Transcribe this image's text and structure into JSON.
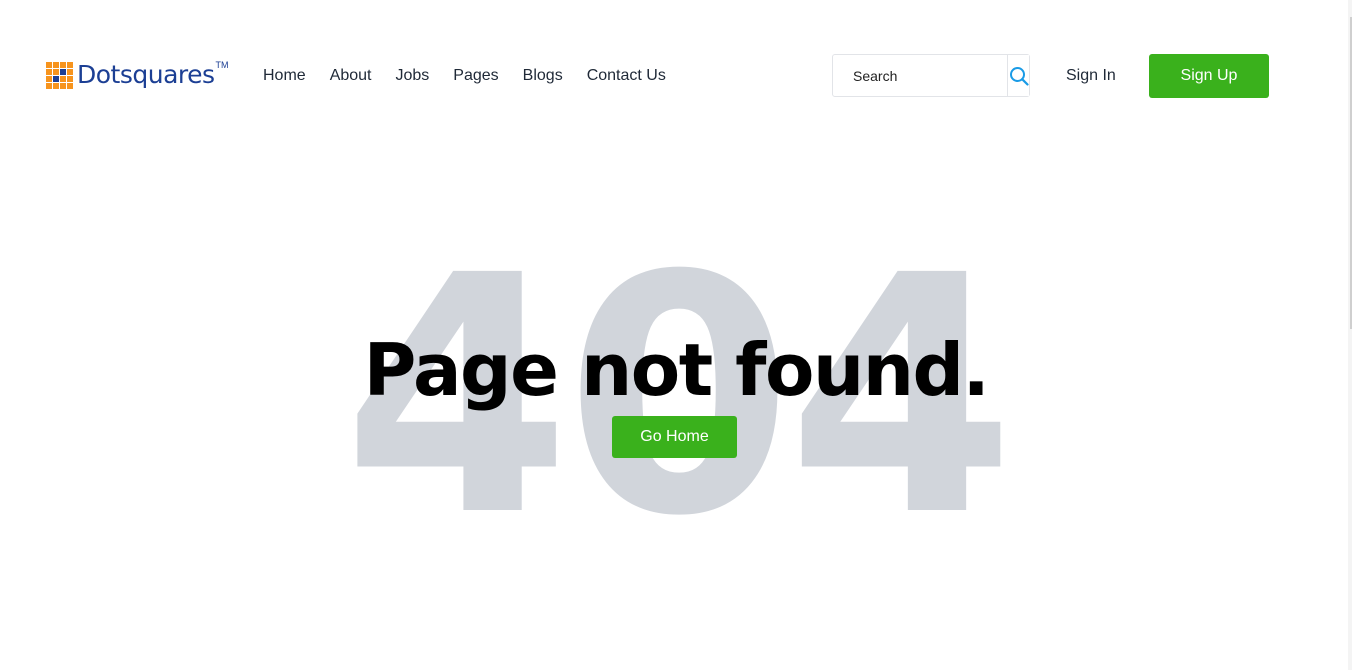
{
  "brand": {
    "name": "Dotsquares",
    "trademark": "TM",
    "colors": {
      "orange": "#f7941d",
      "navy": "#1c3f94"
    }
  },
  "nav": {
    "items": [
      {
        "label": "Home"
      },
      {
        "label": "About"
      },
      {
        "label": "Jobs"
      },
      {
        "label": "Pages"
      },
      {
        "label": "Blogs"
      },
      {
        "label": "Contact Us"
      }
    ]
  },
  "search": {
    "placeholder": "Search",
    "value": "",
    "icon": "search-icon",
    "icon_color": "#1a9be6"
  },
  "auth": {
    "sign_in_label": "Sign In",
    "sign_up_label": "Sign Up",
    "accent_color": "#3ab11c"
  },
  "error": {
    "code": "404",
    "headline": "Page not found.",
    "go_home_label": "Go Home",
    "code_color": "#d1d5db"
  }
}
